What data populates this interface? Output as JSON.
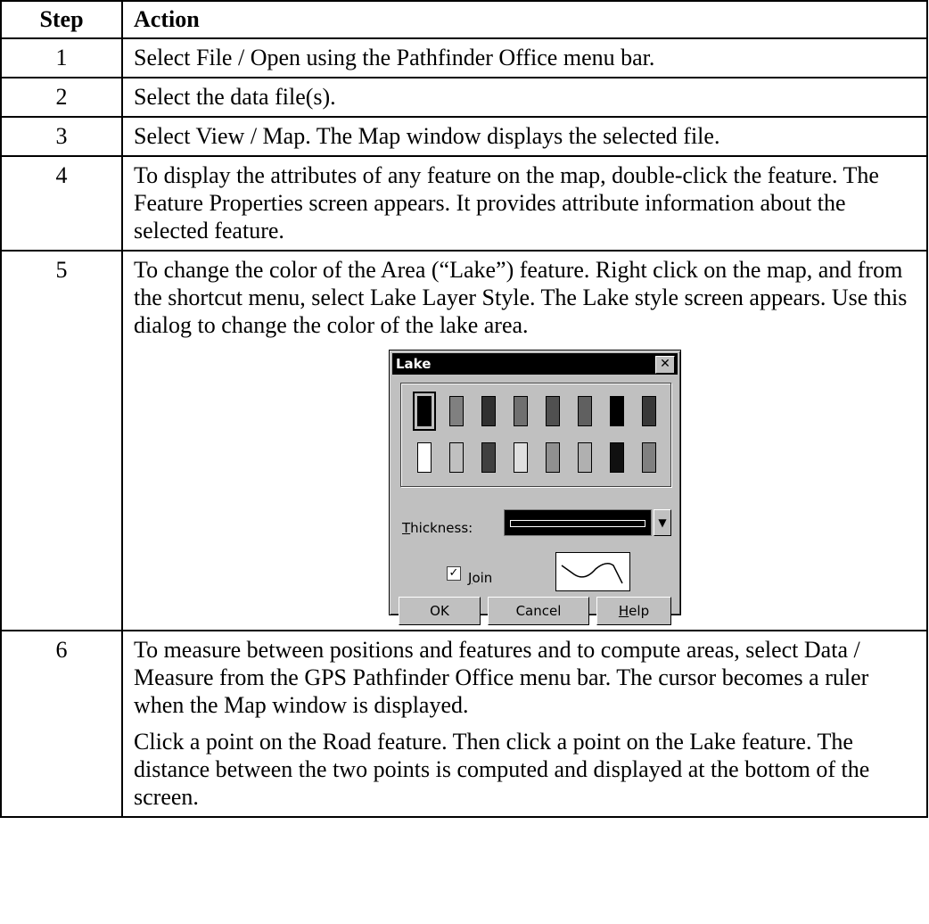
{
  "table": {
    "headers": {
      "step": "Step",
      "action": "Action"
    },
    "rows": [
      {
        "step": "1",
        "action": "Select File / Open using the Pathfinder Office menu bar."
      },
      {
        "step": "2",
        "action": "Select the data file(s)."
      },
      {
        "step": "3",
        "action": "Select View / Map. The Map window displays the selected file."
      },
      {
        "step": "4",
        "action": "To display the attributes of any feature on the map, double-click the feature. The Feature Properties screen appears. It provides attribute information about the selected feature."
      },
      {
        "step": "5",
        "action": "To change the color of the Area (“Lake”) feature. Right click on the map, and from the shortcut menu, select Lake Layer Style. The Lake style screen appears. Use this dialog to change the color of the lake area."
      },
      {
        "step": "6",
        "action": "To measure between positions and features and to compute areas, select Data / Measure from the GPS Pathfinder Office menu bar. The cursor becomes a ruler when the Map window is displayed.",
        "action2": "Click a point on the Road feature. Then click a point on the Lake feature. The distance between the two points is computed and displayed at the bottom of the screen."
      }
    ]
  },
  "dialog": {
    "title": "Lake",
    "close_glyph": "✕",
    "thickness_label_first": "T",
    "thickness_label_rest": "hickness:",
    "dropdown_glyph": "▼",
    "join_checked_glyph": "✓",
    "join_label_first": "J",
    "join_label_rest": "oin",
    "ok_label": "OK",
    "cancel_label": "Cancel",
    "help_label_first": "H",
    "help_label_rest": "elp",
    "swatch_colors": [
      [
        "#000000",
        "#808080",
        "#303030",
        "#707070",
        "#505050",
        "#606060",
        "#000000",
        "#383838"
      ],
      [
        "#ffffff",
        "#c0c0c0",
        "#404040",
        "#e0e0e0",
        "#909090",
        "#b0b0b0",
        "#101010",
        "#808080"
      ]
    ],
    "selected_swatch": "row1-col1"
  }
}
